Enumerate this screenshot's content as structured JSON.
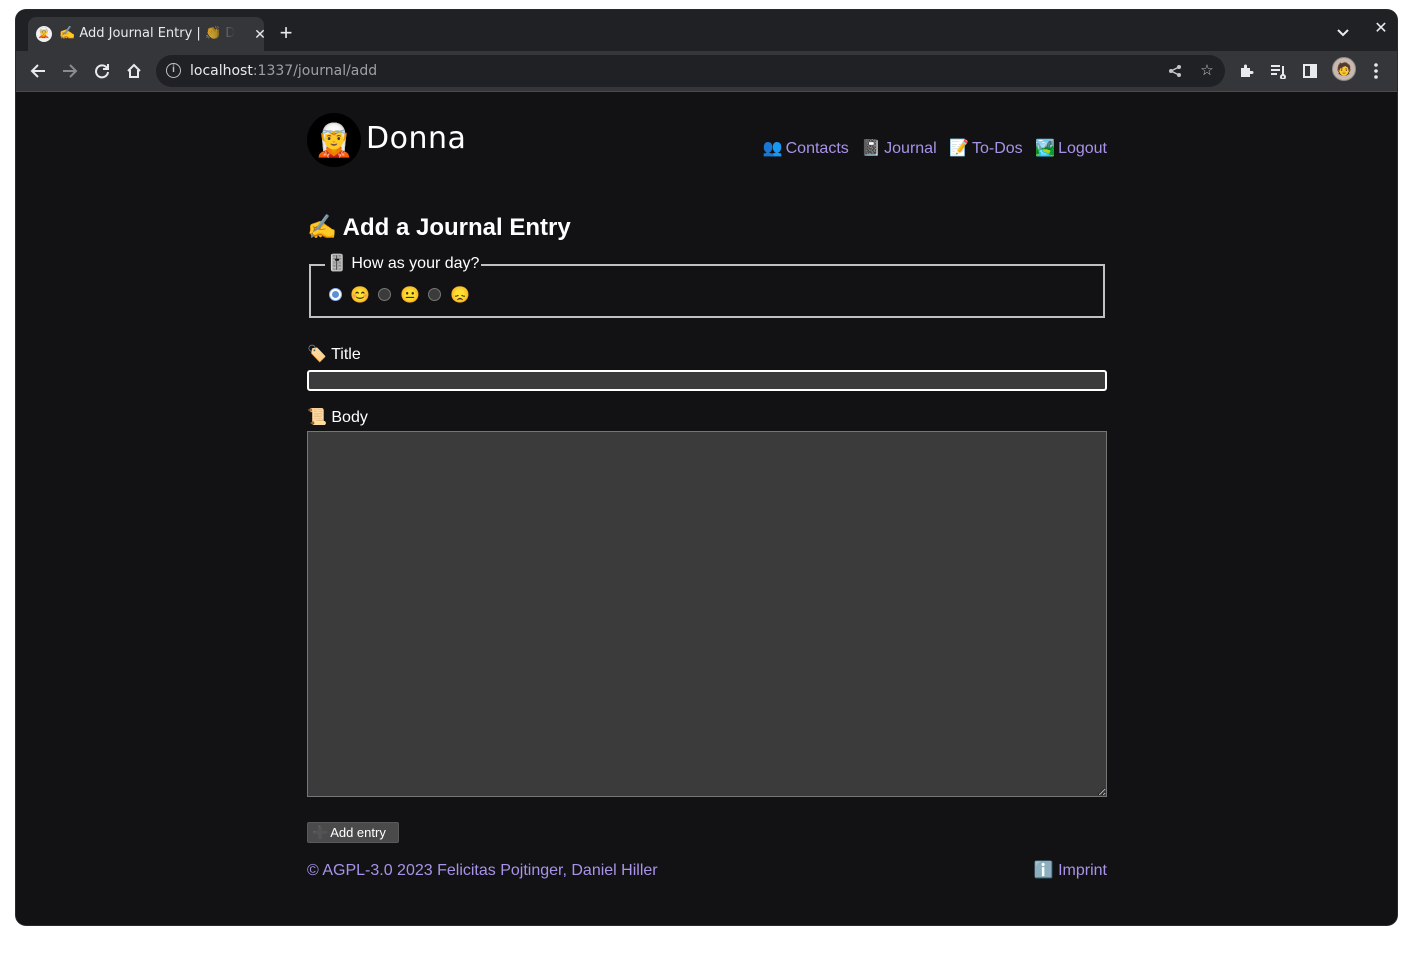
{
  "browser": {
    "tab_title": "✍️ Add Journal Entry | 👏 Donna",
    "tab_favicon": "🧝",
    "close_glyph": "✕",
    "new_tab_glyph": "+",
    "url_host": "localhost",
    "url_path": ":1337/journal/add",
    "icons": [
      "back-icon",
      "forward-icon",
      "reload-icon",
      "home-icon",
      "info-icon",
      "share-icon",
      "star-icon",
      "extensions-icon",
      "reading-list-icon",
      "side-panel-icon",
      "profile-avatar",
      "menu-icon"
    ]
  },
  "site": {
    "logo_emoji": "🧝",
    "name": "Donna"
  },
  "nav": [
    {
      "emoji": "👥",
      "label": "Contacts"
    },
    {
      "emoji": "📓",
      "label": "Journal"
    },
    {
      "emoji": "📝",
      "label": "To-Dos"
    },
    {
      "emoji": "🏞️",
      "label": "Logout"
    }
  ],
  "form": {
    "heading": "✍️ Add a Journal Entry",
    "mood_legend": "🎚️ How as your day?",
    "moods": [
      {
        "emoji": "😊",
        "checked": true
      },
      {
        "emoji": "😐",
        "checked": false
      },
      {
        "emoji": "😞",
        "checked": false
      }
    ],
    "title_label": "🏷️ Title",
    "title_value": "",
    "body_label": "📜 Body",
    "body_value": "",
    "submit_emoji": "➕",
    "submit_label": "Add entry"
  },
  "footer": {
    "copyright": "© AGPL-3.0 2023 Felicitas Pojtinger, Daniel Hiller",
    "imprint": "ℹ️ Imprint"
  },
  "colors": {
    "page_bg": "#121214",
    "link": "#a893e8",
    "input_bg": "#3b3b3b",
    "chrome_toolbar": "#35363a",
    "chrome_tabstrip": "#202124"
  }
}
